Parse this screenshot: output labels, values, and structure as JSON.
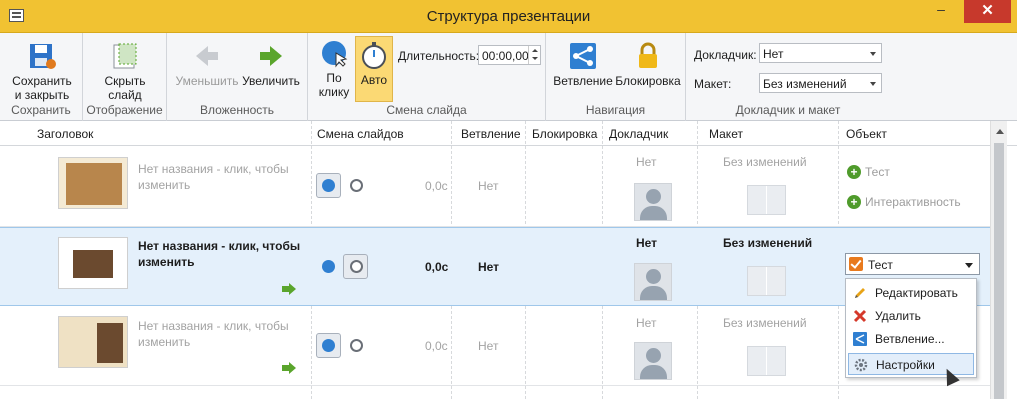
{
  "window": {
    "title": "Структура презентации",
    "minimize": "–",
    "close": "✕"
  },
  "ribbon": {
    "groups": [
      {
        "label": "Сохранить"
      },
      {
        "label": "Отображение"
      },
      {
        "label": "Вложенность"
      },
      {
        "label": "Смена слайда"
      },
      {
        "label": "Навигация"
      },
      {
        "label": "Докладчик и макет"
      }
    ],
    "save_button": {
      "line1": "Сохранить",
      "line2": "и закрыть"
    },
    "hide_button": {
      "line1": "Скрыть",
      "line2": "слайд"
    },
    "decrease_button": "Уменьшить",
    "increase_button": "Увеличить",
    "onclick_button": {
      "line1": "По",
      "line2": "клику"
    },
    "auto_button": "Авто",
    "duration_label": "Длительность:",
    "duration_value": "00:00,00",
    "branching_button": "Ветвление",
    "lock_button": "Блокировка",
    "presenter_label": "Докладчик:",
    "presenter_value": "Нет",
    "layout_label": "Макет:",
    "layout_value": "Без изменений"
  },
  "table": {
    "columns": [
      "Заголовок",
      "Смена слайдов",
      "Ветвление",
      "Блокировка",
      "Докладчик",
      "Макет",
      "Объект"
    ],
    "rows": [
      {
        "title": "Нет названия - клик, чтобы изменить",
        "time": "0,0с",
        "branch": "Нет",
        "presenter": "Нет",
        "layout": "Без изменений",
        "objects": [
          "Тест",
          "Интерактивность"
        ],
        "selected": false
      },
      {
        "title": "Нет названия - клик, чтобы изменить",
        "time": "0,0с",
        "branch": "Нет",
        "presenter": "Нет",
        "layout": "Без изменений",
        "object_value": "Тест",
        "selected": true
      },
      {
        "title": "Нет названия - клик, чтобы изменить",
        "time": "0,0с",
        "branch": "Нет",
        "presenter": "Нет",
        "layout": "Без изменений",
        "selected": false
      }
    ]
  },
  "context_menu": {
    "items": [
      "Редактировать",
      "Удалить",
      "Ветвление...",
      "Настройки"
    ],
    "highlighted": "Настройки"
  },
  "colors": {
    "titlebar": "#f1c232",
    "close": "#c7392c",
    "selected_row": "#e4f0fb",
    "active_button": "#fbd974",
    "green": "#5aa52c"
  }
}
